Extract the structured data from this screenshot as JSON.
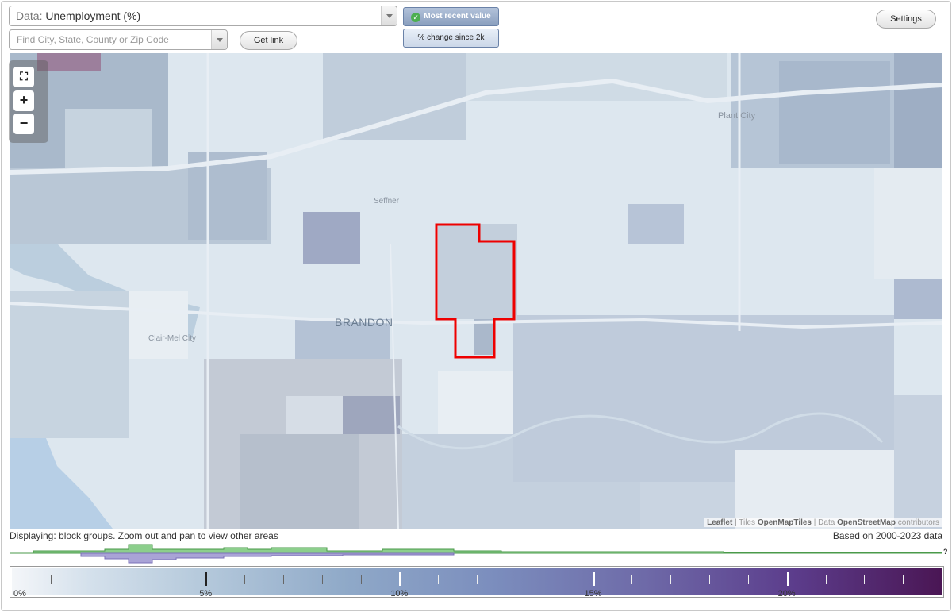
{
  "data_select": {
    "prefix": "Data:",
    "value": "Unemployment (%)"
  },
  "search": {
    "placeholder": "Find City, State, County or Zip Code"
  },
  "buttons": {
    "get_link": "Get link",
    "settings": "Settings"
  },
  "value_toggle": {
    "active": "Most recent value",
    "inactive": "% change since 2k"
  },
  "map": {
    "places": [
      "Plant City",
      "Seffner",
      "BRANDON",
      "Clair-Mel City"
    ],
    "attribution": {
      "leaflet": "Leaflet",
      "tiles_prefix": "Tiles",
      "tiles": "OpenMapTiles",
      "data_prefix": "Data",
      "data": "OpenStreetMap",
      "suffix": "contributors"
    },
    "selection_color": "#ee0000"
  },
  "footer": {
    "displaying": "Displaying: block groups. Zoom out and pan to view other areas",
    "years": "Based on 2000-2023 data",
    "unknown_marker": "?"
  },
  "legend": {
    "labels": [
      "0%",
      "5%",
      "10%",
      "15%",
      "20%"
    ],
    "color_low": "#f4f6f9",
    "color_high": "#4a1654"
  }
}
